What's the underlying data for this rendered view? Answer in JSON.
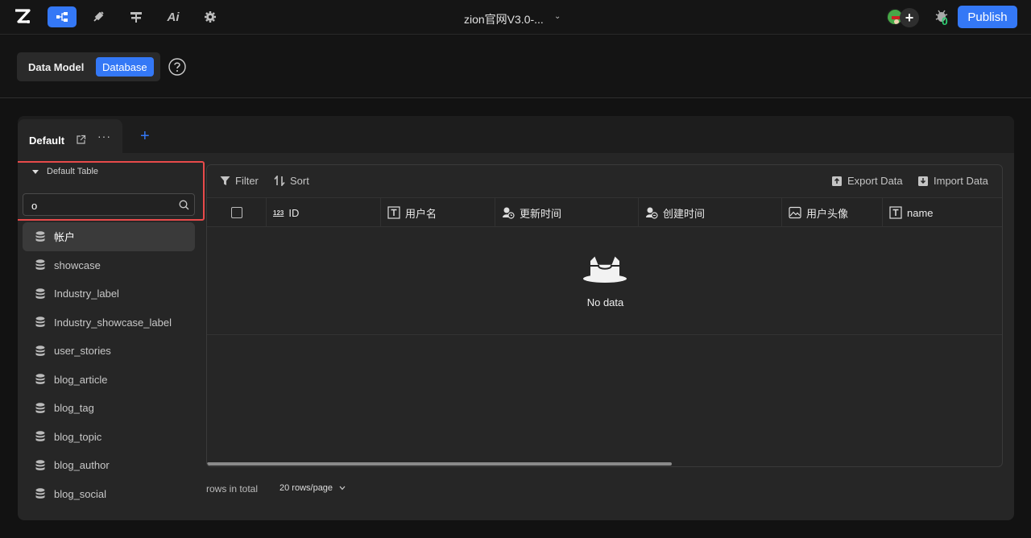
{
  "topbar": {
    "project_title": "zion官网V3.0-...",
    "bug_count": "0",
    "publish_label": "Publish",
    "nav_icons": [
      "flow-icon",
      "plugin-icon",
      "layout-icon",
      "ai-icon",
      "gear-icon"
    ],
    "ai_label": "Ai"
  },
  "subheader": {
    "data_model_label": "Data Model",
    "database_label": "Database"
  },
  "tabs": {
    "default_label": "Default",
    "more": "···",
    "add": "+"
  },
  "sidebar": {
    "group_label": "Default Table",
    "search_value": "o",
    "items": [
      {
        "label": "帐户",
        "selected": true
      },
      {
        "label": "showcase"
      },
      {
        "label": "Industry_label"
      },
      {
        "label": "Industry_showcase_label"
      },
      {
        "label": "user_stories"
      },
      {
        "label": "blog_article"
      },
      {
        "label": "blog_tag"
      },
      {
        "label": "blog_topic"
      },
      {
        "label": "blog_author"
      },
      {
        "label": "blog_social"
      }
    ]
  },
  "grid": {
    "filter_label": "Filter",
    "sort_label": "Sort",
    "export_label": "Export Data",
    "import_label": "Import Data",
    "columns": [
      {
        "label": "ID",
        "icon": "number-icon",
        "icon_text": "123"
      },
      {
        "label": "用户名",
        "icon": "text-icon"
      },
      {
        "label": "更新时间",
        "icon": "datetime-icon"
      },
      {
        "label": "创建时间",
        "icon": "datetime-icon"
      },
      {
        "label": "用户头像",
        "icon": "image-icon"
      },
      {
        "label": "name",
        "icon": "text-icon"
      }
    ],
    "empty_text": "No data"
  },
  "footer": {
    "total_text": "rows in total",
    "page_size": "20 rows/page"
  },
  "colors": {
    "accent": "#3478f6",
    "highlight": "#e84a4a",
    "success": "#2ecc71"
  }
}
